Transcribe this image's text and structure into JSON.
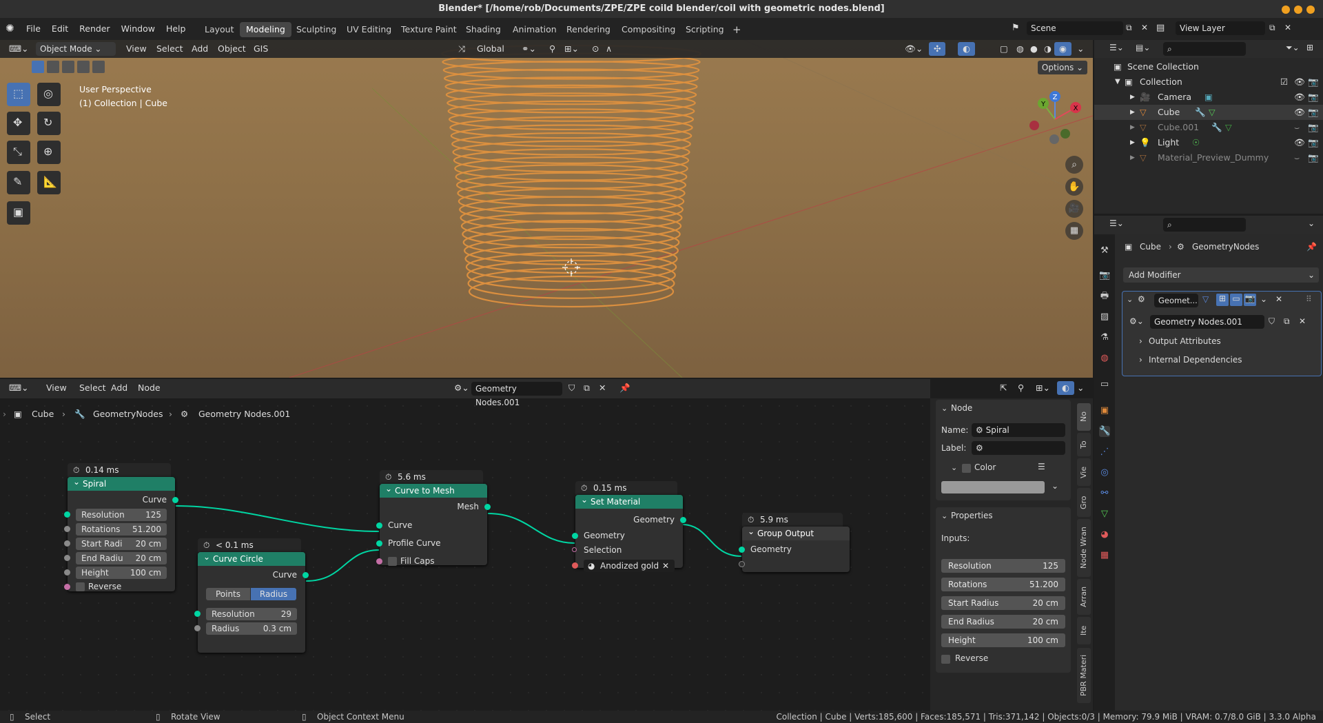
{
  "window": {
    "title": "Blender* [/home/rob/Documents/ZPE/ZPE coild blender/coil with geometric nodes.blend]"
  },
  "menu": [
    "File",
    "Edit",
    "Render",
    "Window",
    "Help"
  ],
  "workspaces": [
    "Layout",
    "Modeling",
    "Sculpting",
    "UV Editing",
    "Texture Paint",
    "Shading",
    "Animation",
    "Rendering",
    "Compositing",
    "Scripting"
  ],
  "active_workspace": "Modeling",
  "scene": {
    "name": "Scene",
    "view_layer": "View Layer"
  },
  "viewport": {
    "mode": "Object Mode",
    "menus": [
      "View",
      "Select",
      "Add",
      "Object",
      "GIS"
    ],
    "transform": "Global",
    "options_label": "Options",
    "info_line1": "User Perspective",
    "info_line2": "(1) Collection | Cube",
    "gizmo": {
      "z": "Z",
      "y": "Y",
      "x": "X"
    }
  },
  "node_editor": {
    "menus": [
      "View",
      "Select",
      "Add",
      "Node"
    ],
    "tree_name": "Geometry Nodes.001",
    "breadcrumb": [
      "Cube",
      "GeometryNodes",
      "Geometry Nodes.001"
    ],
    "nodes": {
      "spiral": {
        "timing": "0.14 ms",
        "title": "Spiral",
        "out": "Curve",
        "fields": [
          {
            "label": "Resolution",
            "value": "125"
          },
          {
            "label": "Rotations",
            "value": "51.200"
          },
          {
            "label": "Start Radi",
            "value": "20 cm"
          },
          {
            "label": "End Radiu",
            "value": "20 cm"
          },
          {
            "label": "Height",
            "value": "100 cm"
          }
        ],
        "reverse": "Reverse"
      },
      "circle": {
        "timing": "< 0.1 ms",
        "title": "Curve Circle",
        "out": "Curve",
        "mode_a": "Points",
        "mode_b": "Radius",
        "fields": [
          {
            "label": "Resolution",
            "value": "29"
          },
          {
            "label": "Radius",
            "value": "0.3 cm"
          }
        ]
      },
      "c2m": {
        "timing": "5.6 ms",
        "title": "Curve to Mesh",
        "out": "Mesh",
        "in1": "Curve",
        "in2": "Profile Curve",
        "in3": "Fill Caps"
      },
      "setmat": {
        "timing": "0.15 ms",
        "title": "Set Material",
        "out": "Geometry",
        "in1": "Geometry",
        "in2": "Selection",
        "material": "Anodized gold"
      },
      "output": {
        "timing": "5.9 ms",
        "title": "Group Output",
        "in1": "Geometry"
      }
    },
    "sidebar": {
      "node_section": "Node",
      "name_label": "Name:",
      "name_value": "Spiral",
      "label_label": "Label:",
      "color_label": "Color",
      "properties": "Properties",
      "inputs_label": "Inputs:",
      "fields": [
        {
          "label": "Resolution",
          "value": "125"
        },
        {
          "label": "Rotations",
          "value": "51.200"
        },
        {
          "label": "Start Radius",
          "value": "20 cm"
        },
        {
          "label": "End Radius",
          "value": "20 cm"
        },
        {
          "label": "Height",
          "value": "100 cm"
        }
      ],
      "reverse": "Reverse",
      "tabs": [
        "No",
        "To",
        "Vie",
        "Gro",
        "Node Wran",
        "Arran",
        "Ite",
        "PBR Materi"
      ]
    }
  },
  "outliner": {
    "root": "Scene Collection",
    "collection": "Collection",
    "items": [
      "Camera",
      "Cube",
      "Cube.001",
      "Light",
      "Material_Preview_Dummy"
    ]
  },
  "properties": {
    "breadcrumb_obj": "Cube",
    "breadcrumb_mod": "GeometryNodes",
    "add_modifier": "Add Modifier",
    "modifier_name": "Geomet...",
    "node_group": "Geometry Nodes.001",
    "sub1": "Output Attributes",
    "sub2": "Internal Dependencies"
  },
  "statusbar": {
    "left": [
      "Select",
      "Rotate View",
      "Object Context Menu"
    ],
    "right": "Collection | Cube | Verts:185,600 | Faces:185,571 | Tris:371,142 | Objects:0/3 | Memory: 79.9 MiB | VRAM: 0.7/8.0 GiB | 3.3.0 Alpha"
  },
  "colors": {
    "node_header": "#1f7f66",
    "socket_geometry": "#00d6a3",
    "selected": "#4772b3",
    "coil": "#d07a30"
  }
}
